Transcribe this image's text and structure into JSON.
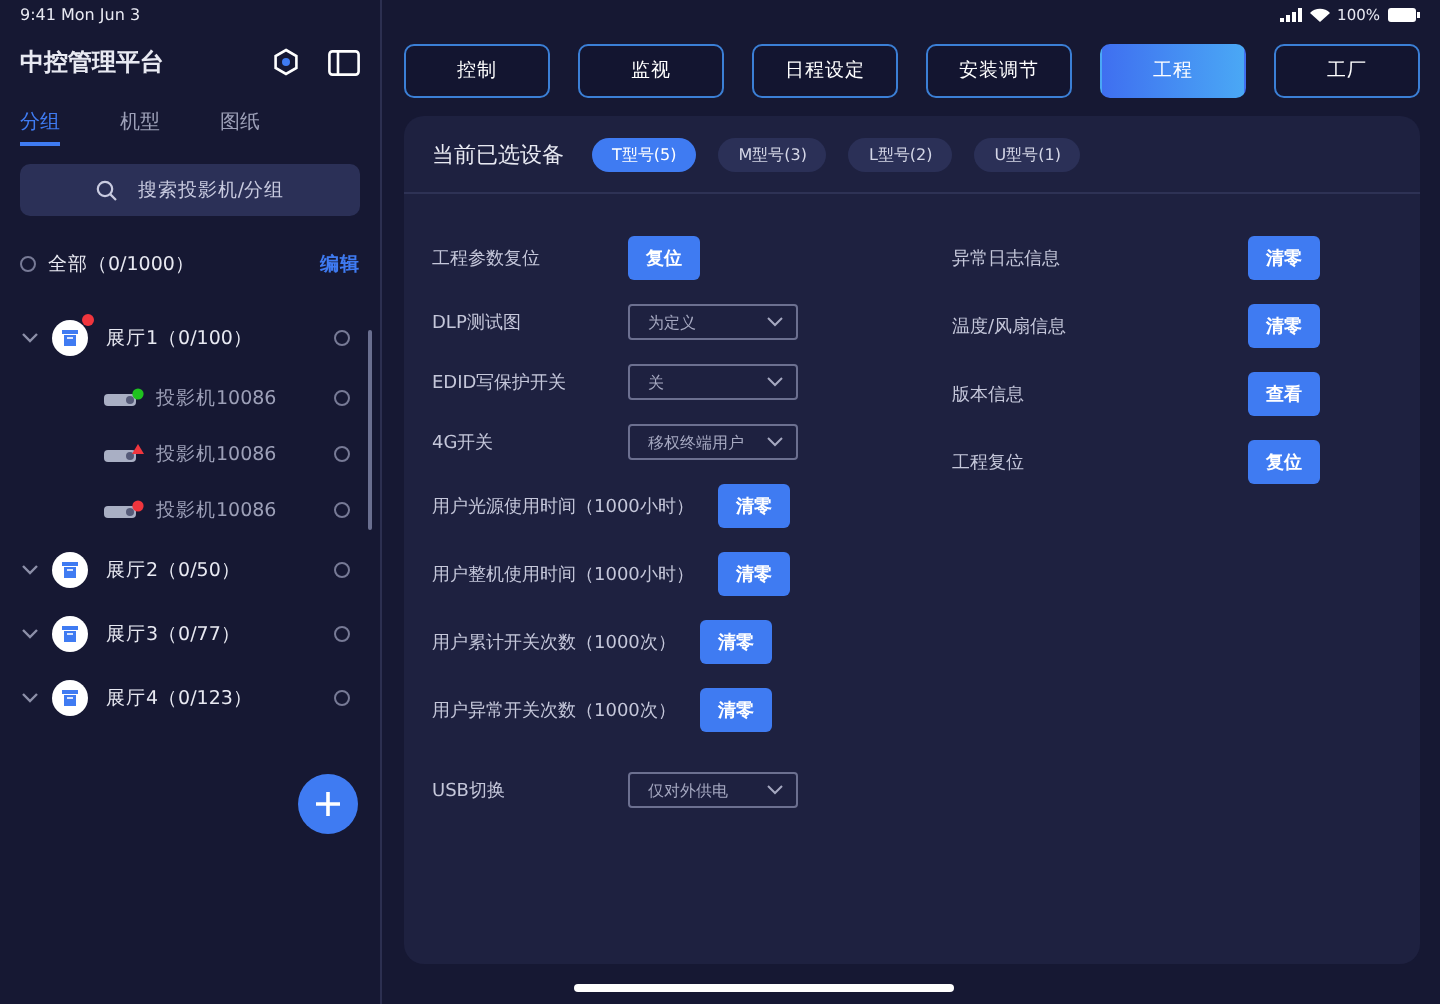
{
  "status_bar": {
    "time": "9:41 Mon Jun 3",
    "battery": "100%"
  },
  "sidebar": {
    "title": "中控管理平台",
    "tabs": [
      {
        "label": "分组",
        "selected": true
      },
      {
        "label": "机型",
        "selected": false
      },
      {
        "label": "图纸",
        "selected": false
      }
    ],
    "search": {
      "placeholder": "搜索投影机/分组"
    },
    "all": {
      "label": "全部（0/1000）",
      "checked": false,
      "edit": "编辑"
    },
    "groups": [
      {
        "label": "展厅1（0/100）",
        "alert": true,
        "checked": false,
        "children": [
          {
            "label": "投影机10086",
            "color": "#1fc21f",
            "kind": "dot",
            "checked": false
          },
          {
            "label": "投影机10086",
            "color": "#f0353d",
            "kind": "warning",
            "checked": false
          },
          {
            "label": "投影机10086",
            "color": "#f0353d",
            "kind": "dot",
            "checked": false
          }
        ]
      },
      {
        "label": "展厅2（0/50）",
        "alert": false,
        "checked": false
      },
      {
        "label": "展厅3（0/77）",
        "alert": false,
        "checked": false
      },
      {
        "label": "展厅4（0/123）",
        "alert": false,
        "checked": false
      }
    ]
  },
  "tabs": [
    {
      "label": "控制",
      "selected": false
    },
    {
      "label": "监视",
      "selected": false
    },
    {
      "label": "日程设定",
      "selected": false
    },
    {
      "label": "安装调节",
      "selected": false
    },
    {
      "label": "工程",
      "selected": true
    },
    {
      "label": "工厂",
      "selected": false
    }
  ],
  "panel": {
    "title": "当前已选设备",
    "models": [
      {
        "label": "T型号(5)",
        "selected": true
      },
      {
        "label": "M型号(3)",
        "selected": false
      },
      {
        "label": "L型号(2)",
        "selected": false
      },
      {
        "label": "U型号(1)",
        "selected": false
      }
    ],
    "left_rows": [
      {
        "kind": "button",
        "label": "工程参数复位",
        "action": "复位"
      },
      {
        "kind": "select",
        "label": "DLP测试图",
        "value": "为定义"
      },
      {
        "kind": "select",
        "label": "EDID写保护开关",
        "value": "关"
      },
      {
        "kind": "select",
        "label": "4G开关",
        "value": "移权终端用户"
      },
      {
        "kind": "button",
        "label": "用户光源使用时间（1000小时）",
        "action": "清零"
      },
      {
        "kind": "button",
        "label": "用户整机使用时间（1000小时）",
        "action": "清零"
      },
      {
        "kind": "button",
        "label": "用户累计开关次数（1000次）",
        "action": "清零"
      },
      {
        "kind": "button",
        "label": "用户异常开关次数（1000次）",
        "action": "清零"
      },
      {
        "kind": "select",
        "label": "USB切换",
        "value": "仅对外供电"
      }
    ],
    "right_rows": [
      {
        "kind": "button",
        "label": "异常日志信息",
        "action": "清零"
      },
      {
        "kind": "button",
        "label": "温度/风扇信息",
        "action": "清零"
      },
      {
        "kind": "button",
        "label": "版本信息",
        "action": "查看"
      },
      {
        "kind": "button",
        "label": "工程复位",
        "action": "复位"
      }
    ]
  }
}
